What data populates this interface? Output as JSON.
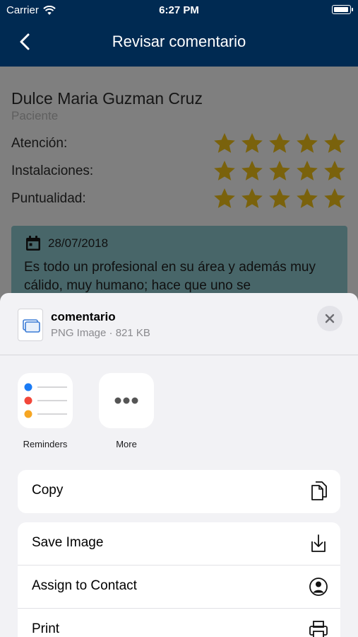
{
  "status_bar": {
    "carrier": "Carrier",
    "time": "6:27 PM",
    "battery_level": 1.0
  },
  "nav": {
    "title": "Revisar comentario",
    "back_icon": "chevron-left-icon"
  },
  "profile": {
    "name": "Dulce Maria Guzman Cruz",
    "role": "Paciente"
  },
  "ratings": [
    {
      "label": "Atención:",
      "stars": 5,
      "max": 5
    },
    {
      "label": "Instalaciones:",
      "stars": 5,
      "max": 5
    },
    {
      "label": "Puntualidad:",
      "stars": 5,
      "max": 5
    }
  ],
  "comment": {
    "date": "28/07/2018",
    "text": "Es todo un profesional en su área y además muy cálido, muy humano; hace que uno se"
  },
  "share_sheet": {
    "file_name": "comentario",
    "file_meta": "PNG Image · 821 KB",
    "apps": [
      {
        "label": "Reminders",
        "icon": "reminders-icon"
      },
      {
        "label": "More",
        "icon": "more-icon"
      }
    ],
    "actions_group1": [
      {
        "label": "Copy",
        "icon": "copy-icon"
      }
    ],
    "actions_group2": [
      {
        "label": "Save Image",
        "icon": "save-image-icon"
      },
      {
        "label": "Assign to Contact",
        "icon": "contact-icon"
      },
      {
        "label": "Print",
        "icon": "print-icon"
      }
    ]
  },
  "colors": {
    "nav_bg": "#002a52",
    "star": "#f5c518",
    "comment_card": "#8fc3c8",
    "sheet_bg": "#f2f2f5"
  }
}
